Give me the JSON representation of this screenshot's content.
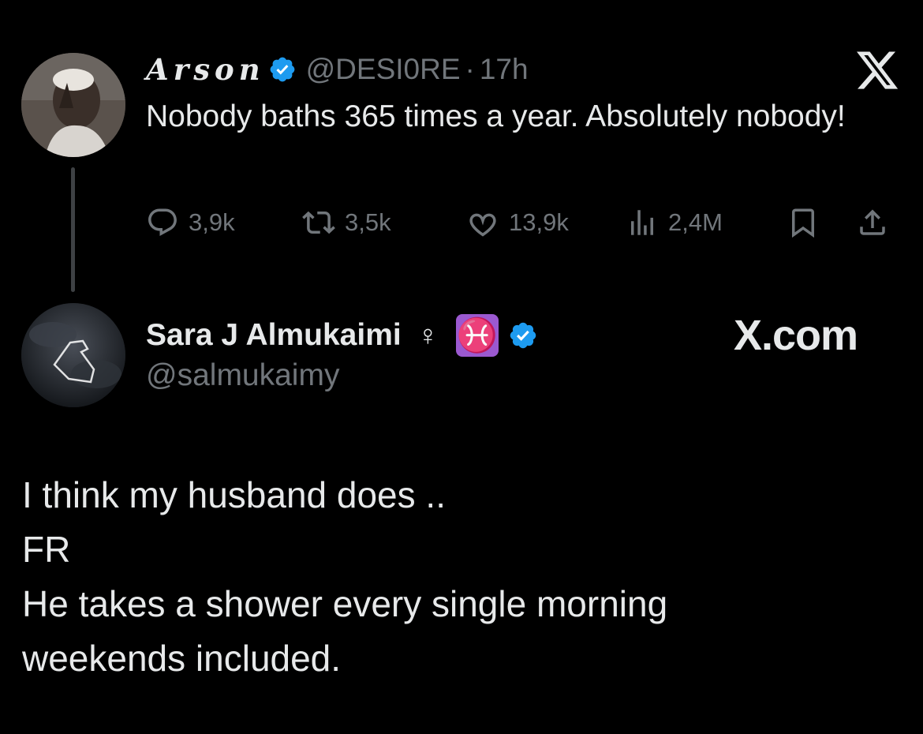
{
  "original_tweet": {
    "display_name": "Arson",
    "handle": "@DESI0RE",
    "separator": "·",
    "time": "17h",
    "text": "Nobody baths 365 times a year. Absolutely nobody!",
    "stats": {
      "replies": "3,9k",
      "retweets": "3,5k",
      "likes": "13,9k",
      "views": "2,4M"
    },
    "close_icon": "x-logo-icon"
  },
  "reply": {
    "display_name": "Sara J Almukaimi",
    "female_symbol": "♀",
    "zodiac_symbol": "♓",
    "handle": "@salmukaimy",
    "watermark": "X.com",
    "lines": [
      "I think my husband does ..",
      "FR",
      "He takes a shower every single morning",
      "weekends included."
    ]
  },
  "colors": {
    "background": "#000000",
    "text": "#e7e9ea",
    "muted": "#71767b",
    "verified_blue": "#1d9bf0",
    "pisces_purple": "#9b59d0"
  }
}
